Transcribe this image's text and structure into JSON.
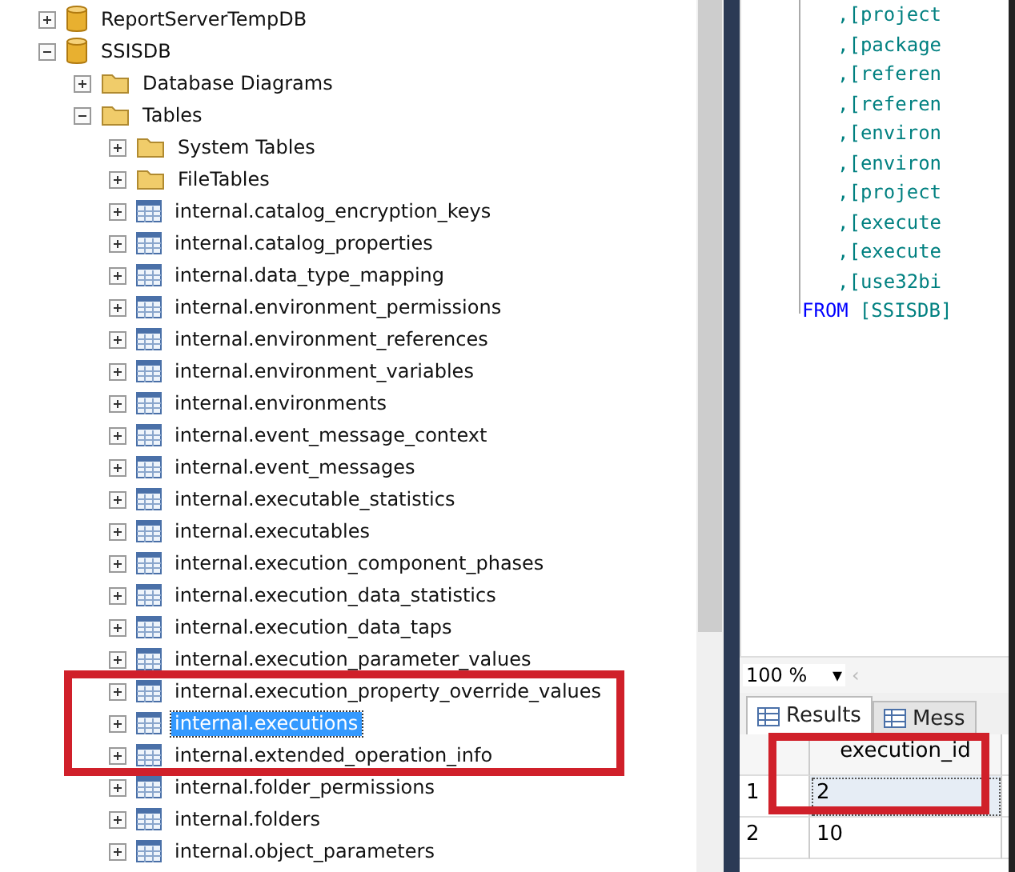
{
  "object_explorer": {
    "nodes": [
      {
        "label": "ReportServerTempDB",
        "kind": "database",
        "expanded": false,
        "selected": false
      },
      {
        "label": "SSISDB",
        "kind": "database",
        "expanded": true,
        "selected": false,
        "children": [
          {
            "label": "Database Diagrams",
            "kind": "folder",
            "expanded": false,
            "selected": false
          },
          {
            "label": "Tables",
            "kind": "folder",
            "expanded": true,
            "selected": false,
            "children": [
              {
                "label": "System Tables",
                "kind": "folder",
                "expanded": false,
                "selected": false
              },
              {
                "label": "FileTables",
                "kind": "folder",
                "expanded": false,
                "selected": false
              },
              {
                "label": "internal.catalog_encryption_keys",
                "kind": "table",
                "expanded": false,
                "selected": false
              },
              {
                "label": "internal.catalog_properties",
                "kind": "table",
                "expanded": false,
                "selected": false
              },
              {
                "label": "internal.data_type_mapping",
                "kind": "table",
                "expanded": false,
                "selected": false
              },
              {
                "label": "internal.environment_permissions",
                "kind": "table",
                "expanded": false,
                "selected": false
              },
              {
                "label": "internal.environment_references",
                "kind": "table",
                "expanded": false,
                "selected": false
              },
              {
                "label": "internal.environment_variables",
                "kind": "table",
                "expanded": false,
                "selected": false
              },
              {
                "label": "internal.environments",
                "kind": "table",
                "expanded": false,
                "selected": false
              },
              {
                "label": "internal.event_message_context",
                "kind": "table",
                "expanded": false,
                "selected": false
              },
              {
                "label": "internal.event_messages",
                "kind": "table",
                "expanded": false,
                "selected": false
              },
              {
                "label": "internal.executable_statistics",
                "kind": "table",
                "expanded": false,
                "selected": false
              },
              {
                "label": "internal.executables",
                "kind": "table",
                "expanded": false,
                "selected": false
              },
              {
                "label": "internal.execution_component_phases",
                "kind": "table",
                "expanded": false,
                "selected": false
              },
              {
                "label": "internal.execution_data_statistics",
                "kind": "table",
                "expanded": false,
                "selected": false
              },
              {
                "label": "internal.execution_data_taps",
                "kind": "table",
                "expanded": false,
                "selected": false
              },
              {
                "label": "internal.execution_parameter_values",
                "kind": "table",
                "expanded": false,
                "selected": false
              },
              {
                "label": "internal.execution_property_override_values",
                "kind": "table",
                "expanded": false,
                "selected": false
              },
              {
                "label": "internal.executions",
                "kind": "table",
                "expanded": false,
                "selected": true
              },
              {
                "label": "internal.extended_operation_info",
                "kind": "table",
                "expanded": false,
                "selected": false
              },
              {
                "label": "internal.folder_permissions",
                "kind": "table",
                "expanded": false,
                "selected": false
              },
              {
                "label": "internal.folders",
                "kind": "table",
                "expanded": false,
                "selected": false
              },
              {
                "label": "internal.object_parameters",
                "kind": "table",
                "expanded": false,
                "selected": false
              }
            ]
          }
        ]
      }
    ]
  },
  "editor": {
    "lines": [
      {
        "kind": "column",
        "text": ",[project"
      },
      {
        "kind": "column",
        "text": ",[package"
      },
      {
        "kind": "column",
        "text": ",[referen"
      },
      {
        "kind": "column",
        "text": ",[referen"
      },
      {
        "kind": "column",
        "text": ",[environ"
      },
      {
        "kind": "column",
        "text": ",[environ"
      },
      {
        "kind": "column",
        "text": ",[project"
      },
      {
        "kind": "column",
        "text": ",[execute"
      },
      {
        "kind": "column",
        "text": ",[execute"
      },
      {
        "kind": "column",
        "text": ",[use32bi"
      },
      {
        "kind": "from",
        "keyword": "FROM",
        "text": "[SSISDB]"
      }
    ]
  },
  "zoom": {
    "value": "100 %",
    "caret": "▾",
    "scroll_arrow": "‹"
  },
  "result_tabs": [
    {
      "label": "Results",
      "selected": true
    },
    {
      "label": "Mess",
      "selected": false
    }
  ],
  "results": {
    "columns": [
      "execution_id"
    ],
    "rows": [
      {
        "number": "1",
        "cells": [
          "2"
        ]
      },
      {
        "number": "2",
        "cells": [
          "10"
        ]
      }
    ]
  }
}
